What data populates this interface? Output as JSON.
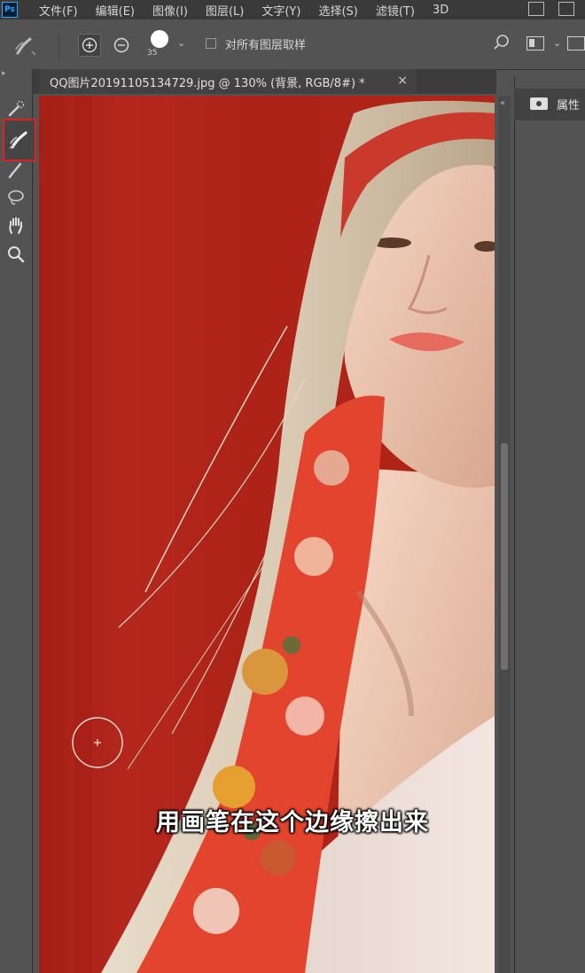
{
  "app": {
    "logo": "Ps",
    "menu": [
      "文件(F)",
      "编辑(E)",
      "图像(I)",
      "图层(L)",
      "文字(Y)",
      "选择(S)",
      "滤镜(T)",
      "3D"
    ]
  },
  "options": {
    "brush_size": "35",
    "sample_all_layers_label": "对所有图层取样",
    "sample_all_layers_checked": false
  },
  "document": {
    "tab_title": "QQ图片20191105134729.jpg @ 130% (背景, RGB/8#) *",
    "close_glyph": "×"
  },
  "toolbar": {
    "active_tool": "refine-edge-brush"
  },
  "panel": {
    "title": "属性"
  },
  "subtitle": "用画笔在这个边缘擦出来",
  "colors": {
    "background_red": "#b4271c",
    "highlight": "#e02020",
    "ui_dark": "#3a3a3a",
    "ui_mid": "#535353"
  }
}
